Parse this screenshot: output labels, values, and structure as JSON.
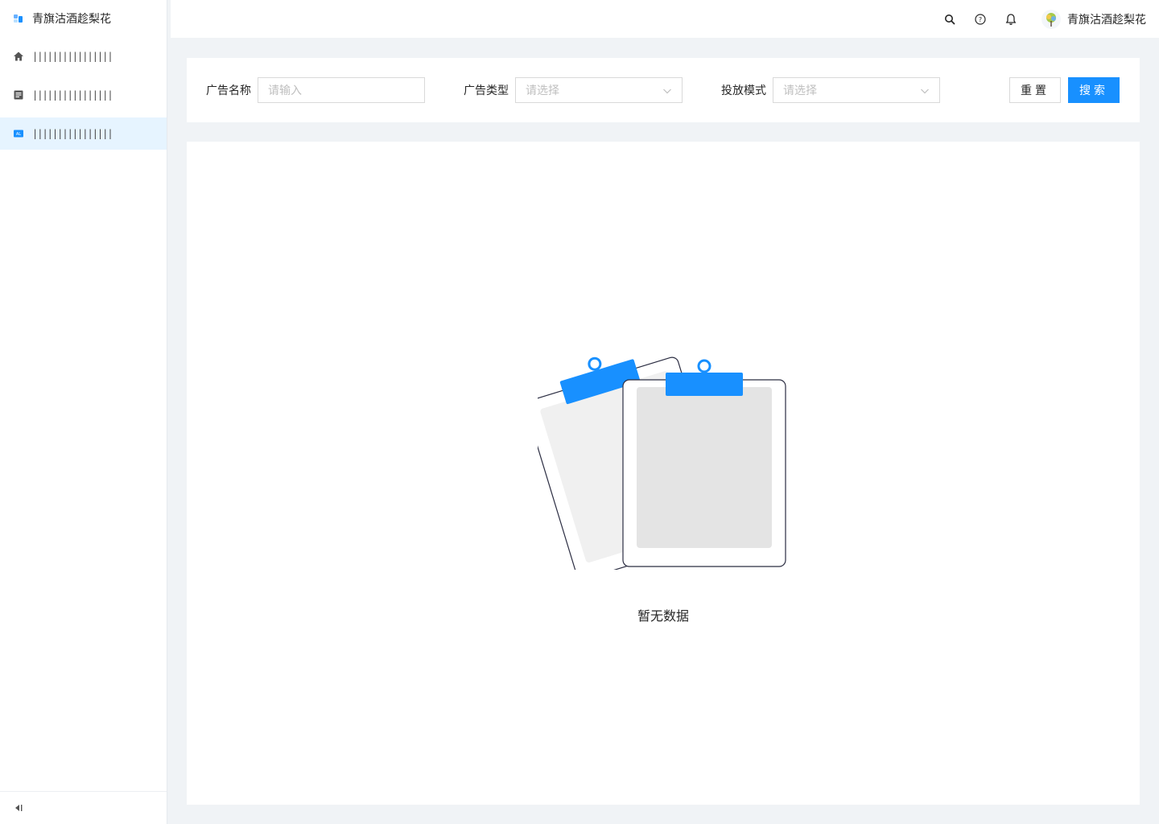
{
  "app": {
    "title": "青旗沽酒趁梨花"
  },
  "sidebar": {
    "items": [
      {
        "label": "||||||||||||||||",
        "icon": "home-icon",
        "active": false
      },
      {
        "label": "||||||||||||||||",
        "icon": "document-icon",
        "active": false
      },
      {
        "label": "||||||||||||||||",
        "icon": "ad-icon",
        "active": true
      }
    ],
    "collapse_icon": "collapse-sidebar-icon"
  },
  "header": {
    "icons": [
      "search-icon",
      "help-icon",
      "bell-icon"
    ],
    "username": "青旗沽酒趁梨花"
  },
  "filter": {
    "ad_name_label": "广告名称",
    "ad_name_placeholder": "请输入",
    "ad_type_label": "广告类型",
    "ad_type_placeholder": "请选择",
    "mode_label": "投放模式",
    "mode_placeholder": "请选择",
    "reset_label": "重置",
    "search_label": "搜索"
  },
  "content": {
    "empty_text": "暂无数据"
  },
  "colors": {
    "primary": "#1890ff",
    "active_bg": "#e6f4ff",
    "page_bg": "#f0f3f6"
  }
}
